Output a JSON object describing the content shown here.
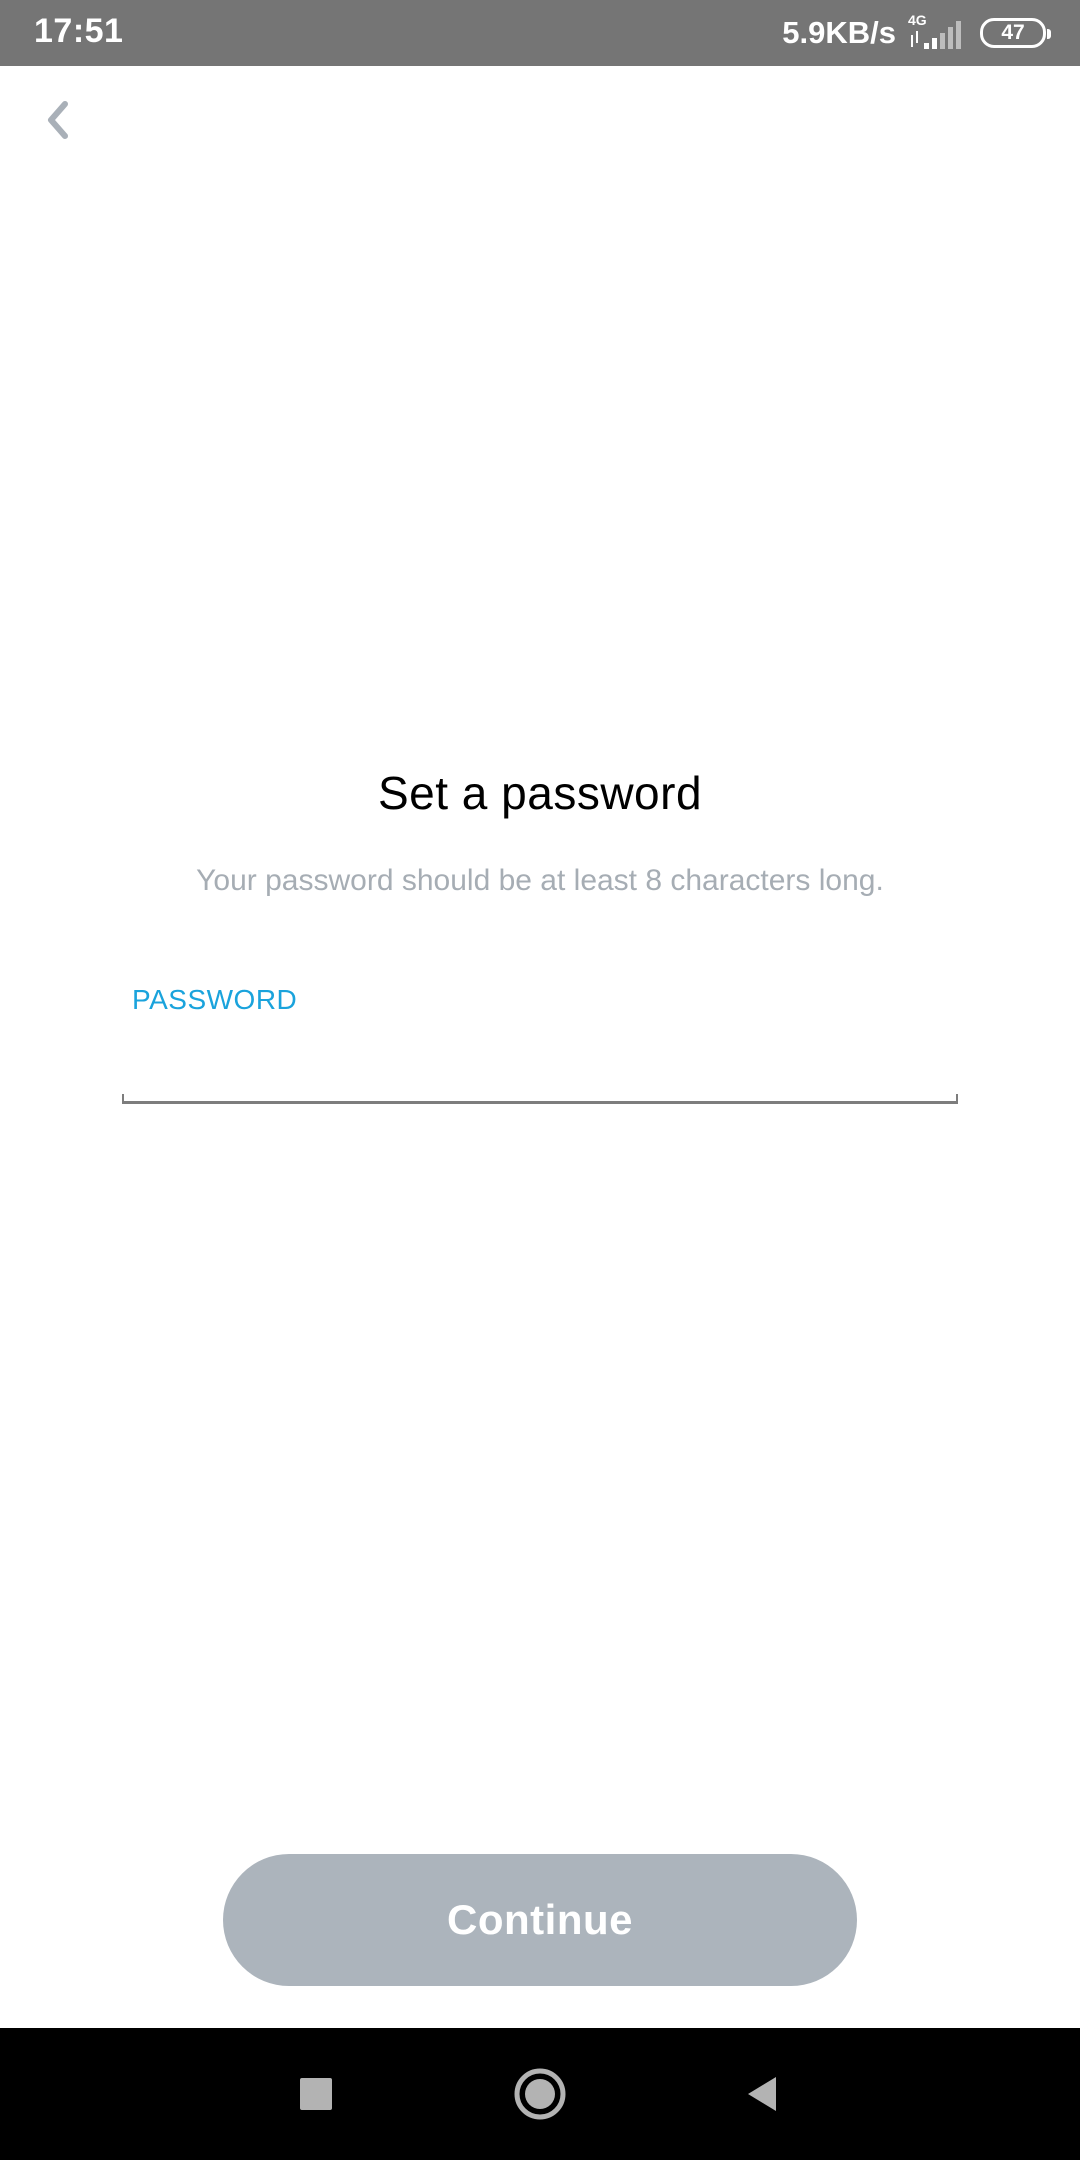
{
  "status_bar": {
    "time": "17:51",
    "network_speed": "5.9KB/s",
    "network_type": "4G",
    "battery_level": "47",
    "icons": [
      "signal-icon",
      "battery-icon"
    ]
  },
  "header": {
    "back_icon": "chevron-left-icon"
  },
  "main": {
    "title": "Set a password",
    "subtitle": "Your password should be at least 8 characters long.",
    "password_label": "PASSWORD",
    "password_value": "",
    "password_placeholder": ""
  },
  "actions": {
    "continue_label": "Continue",
    "continue_enabled": false
  },
  "nav_bar": {
    "icons": [
      "recents-square-icon",
      "home-circle-icon",
      "back-triangle-icon"
    ]
  },
  "colors": {
    "status_bar_bg": "#757575",
    "label_accent": "#1aa3dc",
    "subtitle_text": "#a6adb4",
    "button_disabled_bg": "#acb4bc",
    "back_icon": "#a9b0b8"
  }
}
